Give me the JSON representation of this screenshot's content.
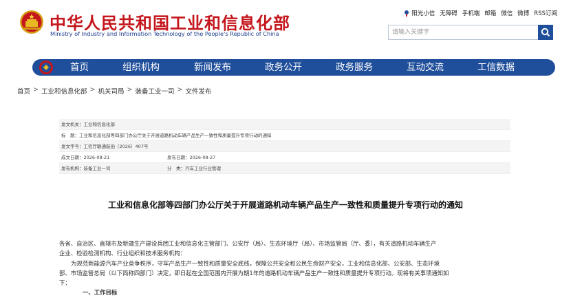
{
  "header": {
    "title": "中华人民共和国工业和信息化部",
    "subtitle": "Ministry of Industry and Information Technology of the People's Republic of China",
    "links": [
      "阳光小信",
      "无障碍",
      "手机端",
      "邮箱",
      "微信",
      "微博",
      "RSS订阅"
    ]
  },
  "search": {
    "placeholder": "请输入关键字",
    "value": ""
  },
  "nav": {
    "items": [
      "首页",
      "组织机构",
      "新闻发布",
      "政务公开",
      "政务服务",
      "互动交流",
      "工信数据"
    ]
  },
  "breadcrumb": [
    "首页",
    "工业和信息化部",
    "机关司局",
    "装备工业一司",
    "文件发布"
  ],
  "meta": {
    "issuer": "发文机关：工业和信息化部",
    "title": "标　题：工业和信息化部等四部门办公厅关于开展道路机动车辆产品生产一致性和质量提升专项行动的通知",
    "doc_number": "发文字号：工信厅联通装函〔2026〕407号",
    "created": "成文日期：2026-08-21",
    "published": "发布日期：2026-08-27",
    "agency": "发布机构：装备工业一司",
    "category": "分　类：汽车工业行业管理"
  },
  "doc": {
    "title": "工业和信息化部等四部门办公厅关于开展道路机动车辆产品生产一致性和质量提升专项行动的通知",
    "para1a": "各省、自治区、直辖市及新疆生产建设兵团工业和信息化主管部门、公安厅（局）、生态环境厅（局）、市场监管局（厅、委），有关道路机动车辆生产",
    "para1b": "企业、检验检测机构、行业组织和技术服务机构：",
    "para2a": "为规范新能源汽车产业竞争秩序，守牢产品生产一致性和质量安全底线，保障公共安全和公民生命财产安全，工业和信息化部、公安部、生态环境",
    "para2b": "部、市场监管总局（以下简称四部门）决定，即日起在全国范围内开展为期1年的道路机动车辆产品生产一致性和质量提升专项行动。现将有关事项通知如",
    "para2c": "下：",
    "heading1": "一、工作目标"
  }
}
